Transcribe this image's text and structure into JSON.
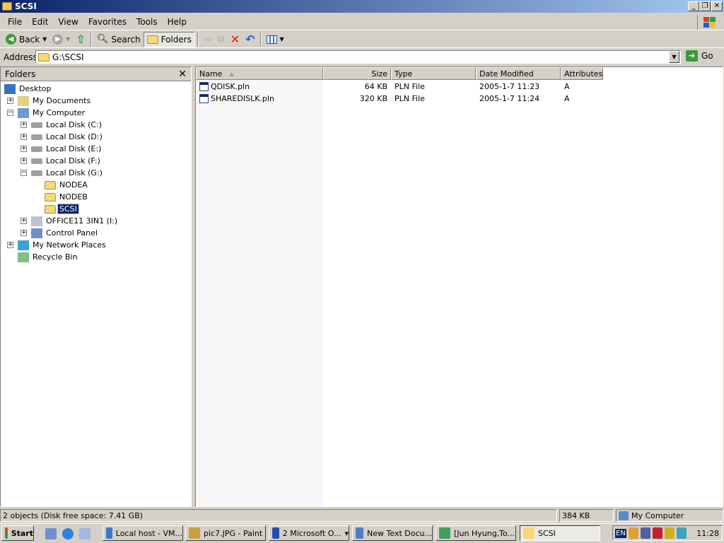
{
  "window": {
    "title": "SCSI"
  },
  "menu": [
    "File",
    "Edit",
    "View",
    "Favorites",
    "Tools",
    "Help"
  ],
  "toolbar": {
    "back": "Back",
    "search": "Search",
    "folders": "Folders"
  },
  "address": {
    "label": "Address",
    "value": "G:\\SCSI",
    "go": "Go"
  },
  "folders_pane": {
    "title": "Folders",
    "tree": [
      {
        "label": "Desktop",
        "level": 0,
        "expander": "",
        "icon": "desktop"
      },
      {
        "label": "My Documents",
        "level": 1,
        "expander": "+",
        "icon": "documents"
      },
      {
        "label": "My Computer",
        "level": 1,
        "expander": "-",
        "icon": "computer"
      },
      {
        "label": "Local Disk (C:)",
        "level": 2,
        "expander": "+",
        "icon": "disk"
      },
      {
        "label": "Local Disk (D:)",
        "level": 2,
        "expander": "+",
        "icon": "disk"
      },
      {
        "label": "Local Disk (E:)",
        "level": 2,
        "expander": "+",
        "icon": "disk"
      },
      {
        "label": "Local Disk (F:)",
        "level": 2,
        "expander": "+",
        "icon": "disk"
      },
      {
        "label": "Local Disk (G:)",
        "level": 2,
        "expander": "-",
        "icon": "disk"
      },
      {
        "label": "NODEA",
        "level": 3,
        "expander": "",
        "icon": "folder"
      },
      {
        "label": "NODEB",
        "level": 3,
        "expander": "",
        "icon": "folder"
      },
      {
        "label": "SCSI",
        "level": 3,
        "expander": "",
        "icon": "folder",
        "selected": true
      },
      {
        "label": "OFFICE11 3IN1 (I:)",
        "level": 2,
        "expander": "+",
        "icon": "cdrom"
      },
      {
        "label": "Control Panel",
        "level": 2,
        "expander": "+",
        "icon": "control-panel"
      },
      {
        "label": "My Network Places",
        "level": 1,
        "expander": "+",
        "icon": "network"
      },
      {
        "label": "Recycle Bin",
        "level": 1,
        "expander": "",
        "icon": "recycle-bin"
      }
    ]
  },
  "file_list": {
    "columns": [
      "Name",
      "Size",
      "Type",
      "Date Modified",
      "Attributes"
    ],
    "sort_column": "Name",
    "rows": [
      {
        "name": "QDISK.pln",
        "size": "64 KB",
        "type": "PLN File",
        "modified": "2005-1-7 11:23",
        "attributes": "A"
      },
      {
        "name": "SHAREDISLK.pln",
        "size": "320 KB",
        "type": "PLN File",
        "modified": "2005-1-7 11:24",
        "attributes": "A"
      }
    ]
  },
  "status": {
    "objects": "2 objects (Disk free space: 7.41 GB)",
    "size": "384 KB",
    "zone": "My Computer"
  },
  "taskbar": {
    "start": "Start",
    "tasks": [
      {
        "label": "Local host - VM...",
        "color": "#3a7ac8"
      },
      {
        "label": "pic7.JPG - Paint",
        "color": "#c8a040"
      },
      {
        "label": "2 Microsoft O...",
        "color": "#2a4ab0",
        "group": true
      },
      {
        "label": "New Text Docu...",
        "color": "#5080c0"
      },
      {
        "label": "[Jun Hyung,To...",
        "color": "#40a060"
      },
      {
        "label": "SCSI",
        "color": "#f6d878",
        "active": true
      }
    ],
    "language": "EN",
    "clock": "11:28"
  }
}
